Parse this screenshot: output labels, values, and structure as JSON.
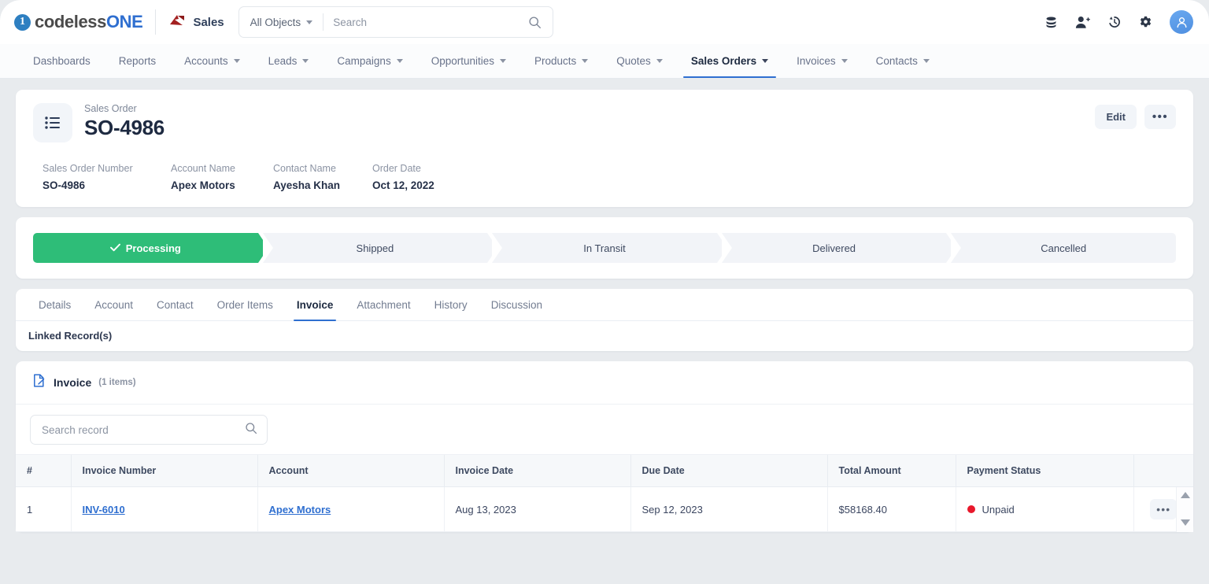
{
  "topbar": {
    "logo_text_a": "codeless",
    "logo_text_b": "ONE",
    "logo_mark": "1",
    "app_name": "Sales",
    "object_selector": "All Objects",
    "search_placeholder": "Search",
    "icons": [
      "database-icon",
      "add-user-icon",
      "history-icon",
      "gear-icon",
      "avatar"
    ]
  },
  "nav": {
    "items": [
      {
        "label": "Dashboards",
        "caret": false,
        "active": false
      },
      {
        "label": "Reports",
        "caret": false,
        "active": false
      },
      {
        "label": "Accounts",
        "caret": true,
        "active": false
      },
      {
        "label": "Leads",
        "caret": true,
        "active": false
      },
      {
        "label": "Campaigns",
        "caret": true,
        "active": false
      },
      {
        "label": "Opportunities",
        "caret": true,
        "active": false
      },
      {
        "label": "Products",
        "caret": true,
        "active": false
      },
      {
        "label": "Quotes",
        "caret": true,
        "active": false
      },
      {
        "label": "Sales Orders",
        "caret": true,
        "active": true
      },
      {
        "label": "Invoices",
        "caret": true,
        "active": false
      },
      {
        "label": "Contacts",
        "caret": true,
        "active": false
      }
    ]
  },
  "record": {
    "object_label": "Sales Order",
    "title": "SO-4986",
    "edit_label": "Edit",
    "more_label": "•••",
    "fields": [
      {
        "label": "Sales Order Number",
        "value": "SO-4986"
      },
      {
        "label": "Account Name",
        "value": "Apex Motors"
      },
      {
        "label": "Contact Name",
        "value": "Ayesha Khan"
      },
      {
        "label": "Order Date",
        "value": "Oct 12, 2022"
      }
    ]
  },
  "pipeline": {
    "active_color": "#2ebd78",
    "stages": [
      {
        "label": "Processing",
        "state": "done"
      },
      {
        "label": "Shipped",
        "state": "todo"
      },
      {
        "label": "In Transit",
        "state": "todo"
      },
      {
        "label": "Delivered",
        "state": "todo"
      },
      {
        "label": "Cancelled",
        "state": "todo"
      }
    ]
  },
  "tabs": {
    "items": [
      {
        "label": "Details",
        "active": false
      },
      {
        "label": "Account",
        "active": false
      },
      {
        "label": "Contact",
        "active": false
      },
      {
        "label": "Order Items",
        "active": false
      },
      {
        "label": "Invoice",
        "active": true
      },
      {
        "label": "Attachment",
        "active": false
      },
      {
        "label": "History",
        "active": false
      },
      {
        "label": "Discussion",
        "active": false
      }
    ],
    "linked_records_label": "Linked Record(s)"
  },
  "related_list": {
    "title": "Invoice",
    "count_label": "(1 items)",
    "search_placeholder": "Search record",
    "columns": [
      "#",
      "Invoice Number",
      "Account",
      "Invoice Date",
      "Due Date",
      "Total Amount",
      "Payment Status",
      ""
    ],
    "rows": [
      {
        "num": "1",
        "invoice_number": "INV-6010",
        "account": "Apex Motors",
        "invoice_date": "Aug 13, 2023",
        "due_date": "Sep 12, 2023",
        "total_amount": "$58168.40",
        "payment_status": "Unpaid",
        "payment_status_color": "#e8182b",
        "row_menu": "•••"
      }
    ]
  }
}
